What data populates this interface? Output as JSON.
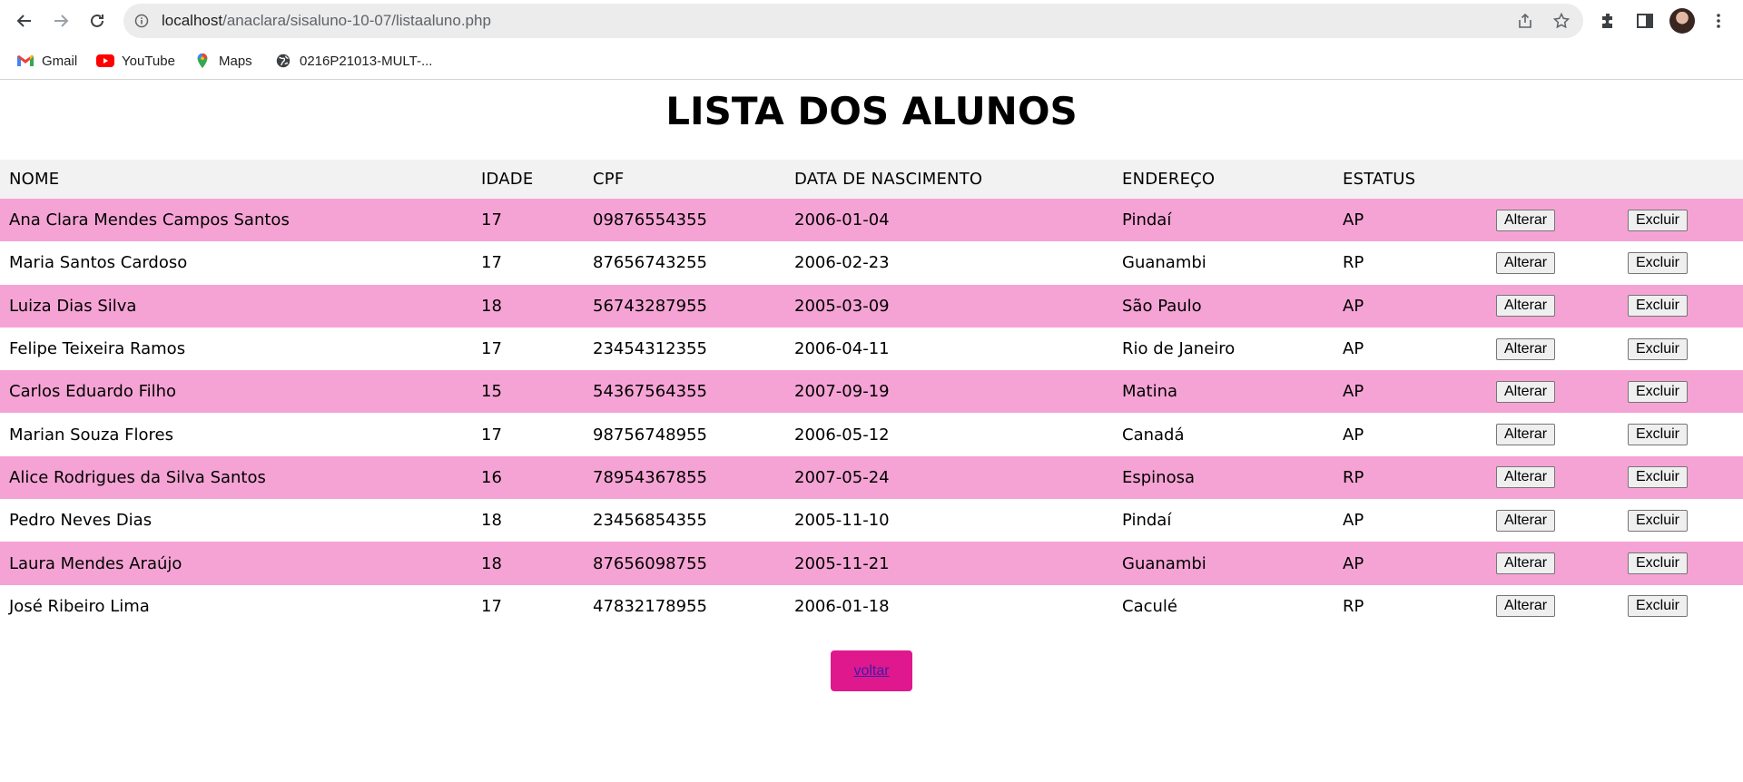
{
  "browser": {
    "url_host": "localhost",
    "url_path": "/anaclara/sisaluno-10-07/listaaluno.php",
    "bookmarks": [
      {
        "label": "Gmail",
        "icon": "gmail-icon"
      },
      {
        "label": "YouTube",
        "icon": "youtube-icon"
      },
      {
        "label": "Maps",
        "icon": "maps-icon"
      },
      {
        "label": "0216P21013-MULT-...",
        "icon": "globe-icon"
      }
    ]
  },
  "page": {
    "title": "LISTA DOS ALUNOS",
    "columns": [
      "NOME",
      "IDADE",
      "CPF",
      "DATA DE NASCIMENTO",
      "ENDEREÇO",
      "ESTATUS"
    ],
    "alterar_label": "Alterar",
    "excluir_label": "Excluir",
    "rows": [
      [
        "Ana Clara Mendes Campos Santos",
        "17",
        "09876554355",
        "2006-01-04",
        "Pindaí",
        "AP"
      ],
      [
        "Maria Santos Cardoso",
        "17",
        "87656743255",
        "2006-02-23",
        "Guanambi",
        "RP"
      ],
      [
        "Luiza Dias Silva",
        "18",
        "56743287955",
        "2005-03-09",
        "São Paulo",
        "AP"
      ],
      [
        "Felipe Teixeira Ramos",
        "17",
        "23454312355",
        "2006-04-11",
        "Rio de Janeiro",
        "AP"
      ],
      [
        "Carlos Eduardo Filho",
        "15",
        "54367564355",
        "2007-09-19",
        "Matina",
        "AP"
      ],
      [
        "Marian Souza Flores",
        "17",
        "98756748955",
        "2006-05-12",
        "Canadá",
        "AP"
      ],
      [
        "Alice Rodrigues da Silva Santos",
        "16",
        "78954367855",
        "2007-05-24",
        "Espinosa",
        "RP"
      ],
      [
        "Pedro Neves Dias",
        "18",
        "23456854355",
        "2005-11-10",
        "Pindaí",
        "AP"
      ],
      [
        "Laura Mendes Araújo",
        "18",
        "87656098755",
        "2005-11-21",
        "Guanambi",
        "AP"
      ],
      [
        "José Ribeiro Lima",
        "17",
        "47832178955",
        "2006-01-18",
        "Caculé",
        "RP"
      ]
    ],
    "voltar_label": "voltar"
  },
  "colors": {
    "row_pink": "#f5a3d4",
    "header_bg": "#f2f2f2",
    "voltar_bg": "#e0188e"
  }
}
